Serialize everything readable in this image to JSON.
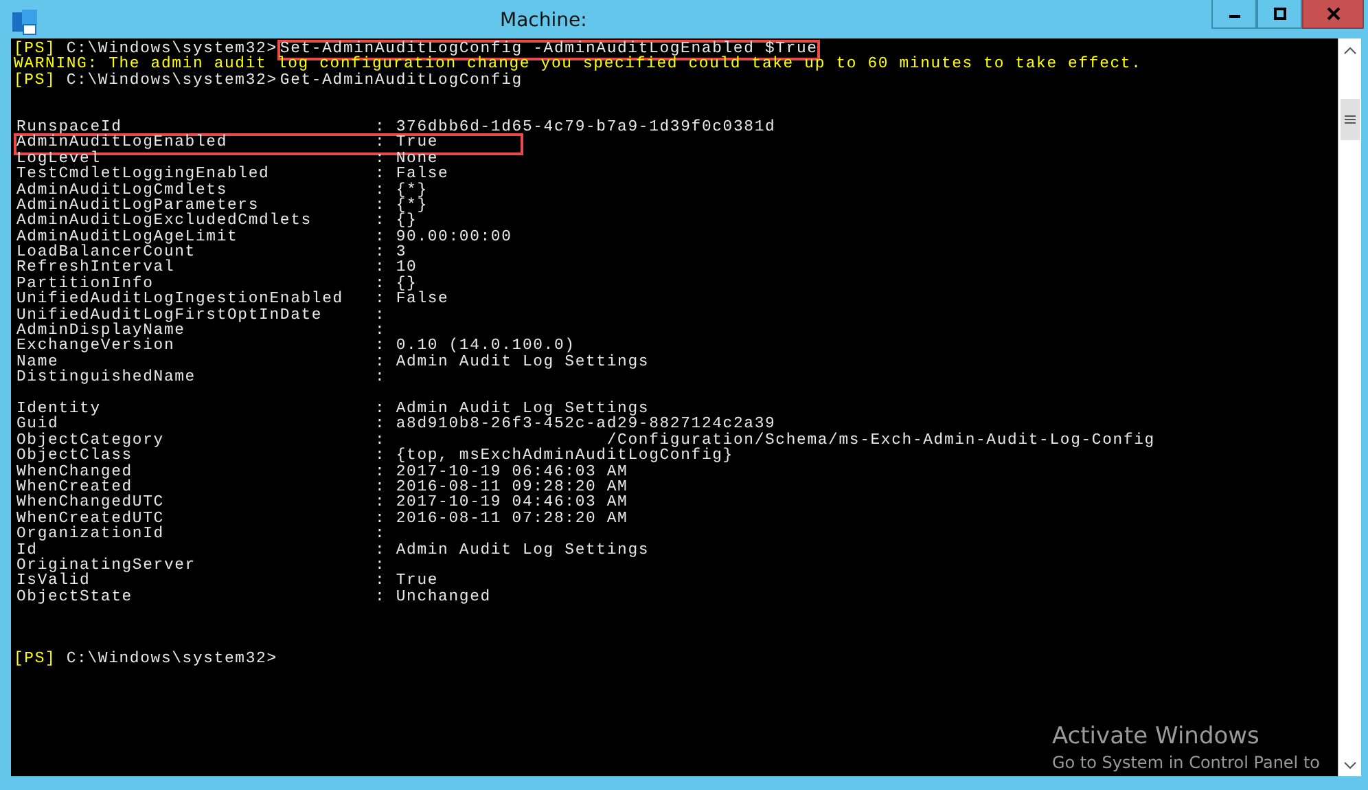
{
  "window": {
    "title": "Machine:"
  },
  "lines": [
    {
      "kind": "prompt",
      "prefix": "[PS]",
      "path": "C:\\Windows\\system32>",
      "command": "Set-AdminAuditLogConfig -AdminAuditLogEnabled $True",
      "highlighted": true
    },
    {
      "kind": "warning",
      "text": "WARNING: The admin audit log configuration change you specified could take up to 60 minutes to take effect."
    },
    {
      "kind": "prompt",
      "prefix": "[PS]",
      "path": "C:\\Windows\\system32>",
      "command": "Get-AdminAuditLogConfig"
    },
    {
      "kind": "blank"
    },
    {
      "kind": "blank"
    },
    {
      "kind": "property",
      "name": "RunspaceId",
      "value": ": 376dbb6d-1d65-4c79-b7a9-1d39f0c0381d",
      "highlighted": false
    },
    {
      "kind": "property",
      "name": "AdminAuditLogEnabled",
      "value": ": True",
      "highlighted": true
    },
    {
      "kind": "property",
      "name": "LogLevel",
      "value": ": None",
      "highlighted": false
    },
    {
      "kind": "property",
      "name": "TestCmdletLoggingEnabled",
      "value": ": False",
      "highlighted": false
    },
    {
      "kind": "property",
      "name": "AdminAuditLogCmdlets",
      "value": ": {*}",
      "highlighted": false
    },
    {
      "kind": "property",
      "name": "AdminAuditLogParameters",
      "value": ": {*}",
      "highlighted": false
    },
    {
      "kind": "property",
      "name": "AdminAuditLogExcludedCmdlets",
      "value": ": {}",
      "highlighted": false
    },
    {
      "kind": "property",
      "name": "AdminAuditLogAgeLimit",
      "value": ": 90.00:00:00",
      "highlighted": false
    },
    {
      "kind": "property",
      "name": "LoadBalancerCount",
      "value": ": 3",
      "highlighted": false
    },
    {
      "kind": "property",
      "name": "RefreshInterval",
      "value": ": 10",
      "highlighted": false
    },
    {
      "kind": "property",
      "name": "PartitionInfo",
      "value": ": {}",
      "highlighted": false
    },
    {
      "kind": "property",
      "name": "UnifiedAuditLogIngestionEnabled",
      "value": ": False",
      "highlighted": false
    },
    {
      "kind": "property",
      "name": "UnifiedAuditLogFirstOptInDate",
      "value": ":",
      "highlighted": false
    },
    {
      "kind": "property",
      "name": "AdminDisplayName",
      "value": ":",
      "highlighted": false
    },
    {
      "kind": "property",
      "name": "ExchangeVersion",
      "value": ": 0.10 (14.0.100.0)",
      "highlighted": false
    },
    {
      "kind": "property",
      "name": "Name",
      "value": ": Admin Audit Log Settings",
      "highlighted": false
    },
    {
      "kind": "property",
      "name": "DistinguishedName",
      "value": ":",
      "highlighted": false
    },
    {
      "kind": "blank"
    },
    {
      "kind": "property",
      "name": "Identity",
      "value": ": Admin Audit Log Settings",
      "highlighted": false
    },
    {
      "kind": "property",
      "name": "Guid",
      "value": ": a8d910b8-26f3-452c-ad29-8827124c2a39",
      "highlighted": false
    },
    {
      "kind": "property",
      "name": "ObjectCategory",
      "value": ":                     /Configuration/Schema/ms-Exch-Admin-Audit-Log-Config",
      "highlighted": false
    },
    {
      "kind": "property",
      "name": "ObjectClass",
      "value": ": {top, msExchAdminAuditLogConfig}",
      "highlighted": false
    },
    {
      "kind": "property",
      "name": "WhenChanged",
      "value": ": 2017-10-19 06:46:03 AM",
      "highlighted": false
    },
    {
      "kind": "property",
      "name": "WhenCreated",
      "value": ": 2016-08-11 09:28:20 AM",
      "highlighted": false
    },
    {
      "kind": "property",
      "name": "WhenChangedUTC",
      "value": ": 2017-10-19 04:46:03 AM",
      "highlighted": false
    },
    {
      "kind": "property",
      "name": "WhenCreatedUTC",
      "value": ": 2016-08-11 07:28:20 AM",
      "highlighted": false
    },
    {
      "kind": "property",
      "name": "OrganizationId",
      "value": ":",
      "highlighted": false
    },
    {
      "kind": "property",
      "name": "Id",
      "value": ": Admin Audit Log Settings",
      "highlighted": false
    },
    {
      "kind": "property",
      "name": "OriginatingServer",
      "value": ":",
      "highlighted": false
    },
    {
      "kind": "property",
      "name": "IsValid",
      "value": ": True",
      "highlighted": false
    },
    {
      "kind": "property",
      "name": "ObjectState",
      "value": ": Unchanged",
      "highlighted": false
    },
    {
      "kind": "blank"
    },
    {
      "kind": "blank"
    },
    {
      "kind": "blank"
    },
    {
      "kind": "prompt",
      "prefix": "[PS]",
      "path": "C:\\Windows\\system32>"
    }
  ],
  "activation": {
    "title": "Activate Windows",
    "text": "Go to System in Control Panel to"
  }
}
